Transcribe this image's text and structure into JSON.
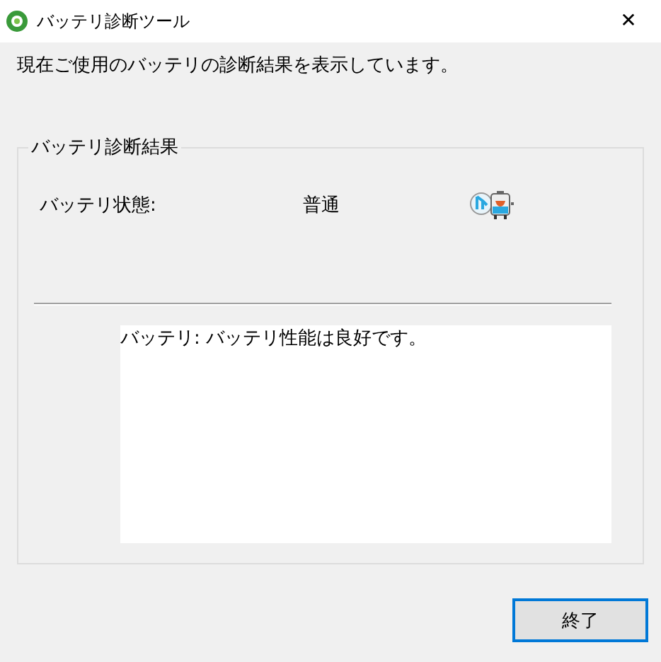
{
  "window": {
    "title": "バッテリ診断ツール",
    "close": "✕"
  },
  "description": "現在ご使用のバッテリの診断結果を表示しています。",
  "group": {
    "title": "バッテリ診断結果",
    "status_label": "バッテリ状態:",
    "status_value": "普通",
    "result_text": "バッテリ: バッテリ性能は良好です。"
  },
  "buttons": [
    {
      "label": "終了",
      "focused": true
    }
  ]
}
